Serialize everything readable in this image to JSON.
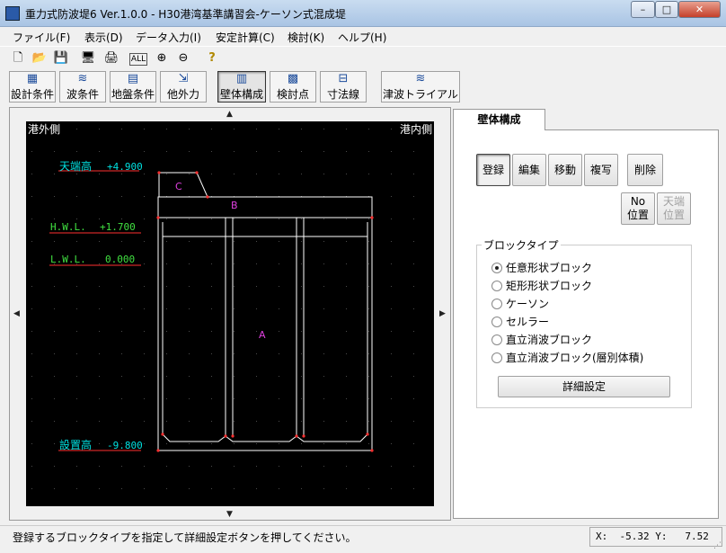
{
  "window": {
    "title": "重力式防波堤6 Ver.1.0.0 - H30港湾基準講習会-ケーソン式混成堤",
    "minimize": "–",
    "maximize": "□",
    "close": "✕"
  },
  "menu": [
    "ファイル(F)",
    "表示(D)",
    "データ入力(I)",
    "安定計算(C)",
    "検討(K)",
    "ヘルプ(H)"
  ],
  "toolbar_small": [
    {
      "name": "new-icon",
      "glyph": "🗋"
    },
    {
      "name": "open-icon",
      "glyph": "📂"
    },
    {
      "name": "save-icon",
      "glyph": "💾"
    },
    {
      "name": "preview-icon",
      "glyph": "🖥"
    },
    {
      "name": "print-icon",
      "glyph": "🖨"
    },
    {
      "name": "all-icon",
      "glyph": "ALL"
    },
    {
      "name": "zoom-in-icon",
      "glyph": "⊕"
    },
    {
      "name": "zoom-out-icon",
      "glyph": "⊖"
    },
    {
      "name": "help-icon",
      "glyph": "?"
    }
  ],
  "toolbar_large": [
    {
      "name": "design-conditions",
      "label": "設計条件",
      "glyph": "▦"
    },
    {
      "name": "wave-conditions",
      "label": "波条件",
      "glyph": "≋"
    },
    {
      "name": "ground-conditions",
      "label": "地盤条件",
      "glyph": "▤"
    },
    {
      "name": "external-force",
      "label": "他外力",
      "glyph": "⇲"
    },
    {
      "name": "wall-structure",
      "label": "壁体構成",
      "glyph": "▥"
    },
    {
      "name": "check-points",
      "label": "検討点",
      "glyph": "▩"
    },
    {
      "name": "dimension-lines",
      "label": "寸法線",
      "glyph": "⊟"
    },
    {
      "name": "tsunami-trial",
      "label": "津波トライアル",
      "glyph": "≋"
    }
  ],
  "canvas": {
    "left_label": "港外側",
    "right_label": "港内側",
    "crown_label": "天端高",
    "crown_value": "+4.900",
    "hwl_label": "H.W.L.",
    "hwl_value": "+1.700",
    "lwl_label": "L.W.L.",
    "lwl_value": "0.000",
    "base_label": "設置高",
    "base_value": "-9.800",
    "block_a": "A",
    "block_b": "B",
    "block_c": "C"
  },
  "panel": {
    "tab": "壁体構成",
    "buttons": [
      "登録",
      "編集",
      "移動",
      "複写",
      "削除"
    ],
    "no_position": [
      "No",
      "位置"
    ],
    "crown_position": [
      "天端",
      "位置"
    ],
    "group_label": "ブロックタイプ",
    "block_types": [
      "任意形状ブロック",
      "矩形形状ブロック",
      "ケーソン",
      "セルラー",
      "直立消波ブロック",
      "直立消波ブロック(層別体積)"
    ],
    "selected_index": 0,
    "detail_button": "詳細設定"
  },
  "status": {
    "message": "登録するブロックタイプを指定して詳細設定ボタンを押してください。",
    "x_label": "X:",
    "x_value": "-5.32",
    "y_label": "Y:",
    "y_value": "7.52"
  }
}
